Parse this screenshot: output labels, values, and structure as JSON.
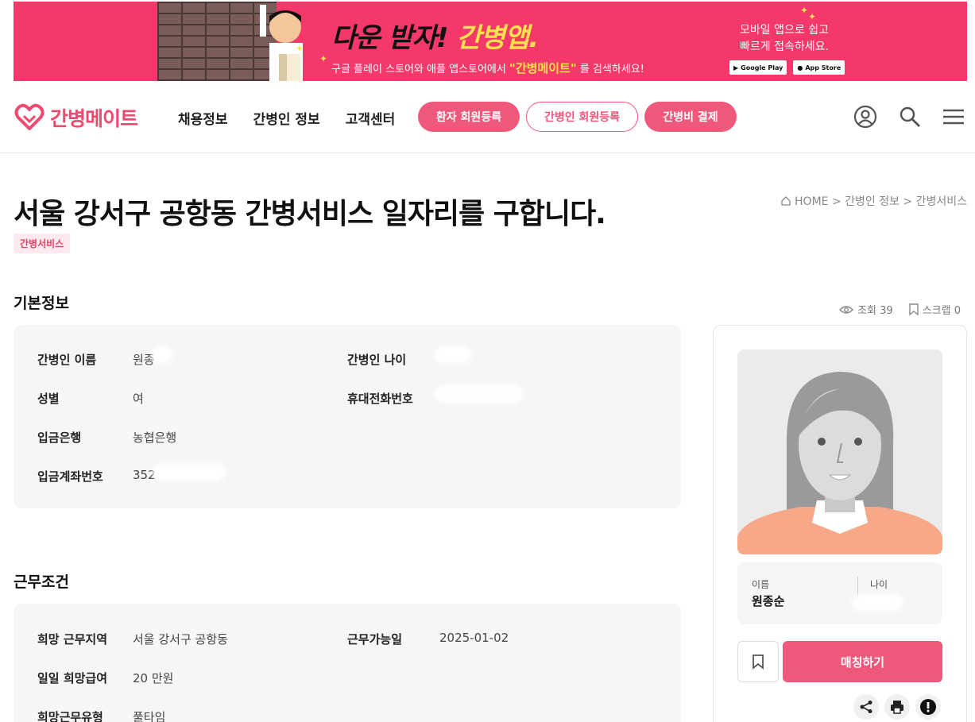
{
  "banner": {
    "headline_black": "다운 받자!",
    "headline_yellow": "간병앱.",
    "sub_pre": "구글 플레이 스토어와 애플 앱스토어에서",
    "sub_quote": "\"간병메이트\"",
    "sub_post": "를 검색하세요!",
    "right_line1": "모바일 앱으로 쉽고",
    "right_line2": "빠르게 접속하세요.",
    "google_play": "Google Play",
    "app_store": "App Store"
  },
  "header": {
    "logo": "간병메이트",
    "nav": [
      "채용정보",
      "간병인 정보",
      "고객센터"
    ],
    "btn_patient": "환자 회원등록",
    "btn_caregiver": "간병인 회원등록",
    "btn_pay": "간병비 결제",
    "icons": [
      "user-icon",
      "search-icon",
      "menu-icon"
    ]
  },
  "page": {
    "title": "서울 강서구 공항동 간병서비스 일자리를 구합니다.",
    "tag": "간병서비스",
    "breadcrumb": "HOME > 간병인 정보 > 간병서비스",
    "views": "조회 39",
    "scraps": "스크랩 0"
  },
  "basic": {
    "title": "기본정보",
    "name_label": "간병인 이름",
    "name_value": "원종",
    "age_label": "간병인 나이",
    "gender_label": "성별",
    "gender_value": "여",
    "phone_label": "휴대전화번호",
    "bank_label": "입금은행",
    "bank_value": "농협은행",
    "account_label": "입금계좌번호",
    "account_value": "352"
  },
  "work": {
    "title": "근무조건",
    "region_label": "희망 근무지역",
    "region_value": "서울 강서구 공항동",
    "date_label": "근무가능일",
    "date_value": "2025-01-02",
    "pay_label": "일일 희망급여",
    "pay_value": "20 만원",
    "type_label": "희망근무유형",
    "type_value": "풀타임"
  },
  "profile": {
    "name_label": "이름",
    "name_value": "원종순",
    "age_label": "나이",
    "match_button": "매칭하기"
  },
  "colors": {
    "brand": "#f0587b",
    "banner": "#f4386a",
    "yellow": "#ffe14d"
  }
}
